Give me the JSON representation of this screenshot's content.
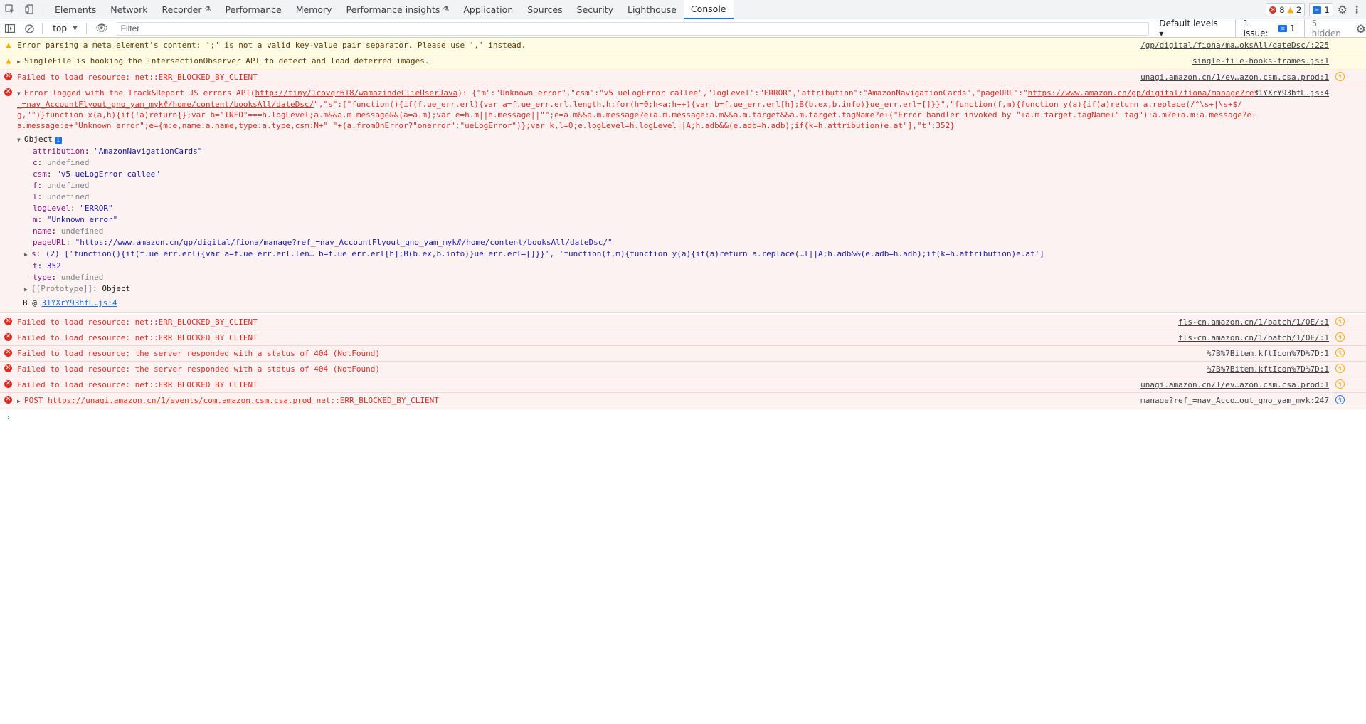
{
  "tabs": [
    {
      "label": "Elements"
    },
    {
      "label": "Network"
    },
    {
      "label": "Recorder",
      "flask": "⚗"
    },
    {
      "label": "Performance"
    },
    {
      "label": "Memory"
    },
    {
      "label": "Performance insights",
      "flask": "⚗"
    },
    {
      "label": "Application"
    },
    {
      "label": "Sources"
    },
    {
      "label": "Security"
    },
    {
      "label": "Lighthouse"
    },
    {
      "label": "Console"
    }
  ],
  "counts": {
    "errors": "8",
    "warnings": "2",
    "messages": "1"
  },
  "toolbar": {
    "context": "top",
    "filter_placeholder": "Filter",
    "levels": "Default levels ▾",
    "issues_label": "1 Issue:",
    "issues_count": "1",
    "hidden": "5 hidden"
  },
  "messages": {
    "m0": {
      "text": "Error parsing a meta element's content: ';' is not a valid key-value pair separator. Please use ',' instead.",
      "source": "/gp/digital/fiona/ma…oksAll/dateDsc/:225"
    },
    "m1": {
      "text": "SingleFile is hooking the IntersectionObserver API to detect and load deferred images.",
      "source": "single-file-hooks-frames.js:1"
    },
    "m2": {
      "text": "Failed to load resource: net::ERR_BLOCKED_BY_CLIENT",
      "source": "unagi.amazon.cn/1/ev…azon.csm.csa.prod:1"
    },
    "m3": {
      "prefix": "Error logged with the Track&Report JS errors API(",
      "api_link": "http://tiny/1covqr618/wamazindeClieUserJava",
      "after_link": "): {\"m\":\"Unknown error\",\"csm\":\"v5 ueLogError callee\",\"logLevel\":\"ERROR\",\"attribution\":\"AmazonNavigationCards\",\"pageURL\":\"",
      "page_link": "https://www.amazon.cn/gp/digital/fiona/manage?ref_=nav_AccountFlyout_gno_yam_myk#/home/content/booksAll/dateDsc/",
      "rest": "\",\"s\":[\"function(){if(f.ue_err.erl){var a=f.ue_err.erl.length,h;for(h=0;h<a;h++){var b=f.ue_err.erl[h];B(b.ex,b.info)}ue_err.erl=[]}}\",\"function(f,m){function y(a){if(a)return a.replace(/^\\s+|\\s+$/g,\"\")}function x(a,h){if(!a)return{};var b=\"INFO\"===h.logLevel;a.m&&a.m.message&&(a=a.m);var e=h.m||h.message||\"\";e=a.m&&a.m.message?e+a.m.message:a.m&&a.m.target&&a.m.target.tagName?e+(\"Error handler invoked by \"+a.m.target.tagName+\" tag\"):a.m?e+a.m:a.message?e+a.message:e+\"Unknown error\";e={m:e,name:a.name,type:a.type,csm:N+\" \"+(a.fromOnError?\"onerror\":\"ueLogError\")};var k,l=0;e.logLevel=h.logLevel||A;h.adb&&(e.adb=h.adb);if(k=h.attribution)e.at\"],\"t\":352}",
      "source": "31YXrY93hfL.js:4"
    },
    "m4": {
      "text": "Failed to load resource: net::ERR_BLOCKED_BY_CLIENT",
      "source": "fls-cn.amazon.cn/1/batch/1/OE/:1"
    },
    "m5": {
      "text": "Failed to load resource: net::ERR_BLOCKED_BY_CLIENT",
      "source": "fls-cn.amazon.cn/1/batch/1/OE/:1"
    },
    "m6": {
      "text": "Failed to load resource: the server responded with a status of 404 (NotFound)",
      "source": "%7B%7Bitem.kftIcon%7D%7D:1"
    },
    "m7": {
      "text": "Failed to load resource: the server responded with a status of 404 (NotFound)",
      "source": "%7B%7Bitem.kftIcon%7D%7D:1"
    },
    "m8": {
      "text": "Failed to load resource: net::ERR_BLOCKED_BY_CLIENT",
      "source": "unagi.amazon.cn/1/ev…azon.csm.csa.prod:1"
    },
    "m9": {
      "method": "POST",
      "url": "https://unagi.amazon.cn/1/events/com.amazon.csm.csa.prod",
      "error": "net::ERR_BLOCKED_BY_CLIENT",
      "source": "manage?ref_=nav_Acco…out_gno_yam_myk:247"
    }
  },
  "object": {
    "header": "Object",
    "props": {
      "attribution": {
        "key": "attribution",
        "val": "\"AmazonNavigationCards\""
      },
      "c": {
        "key": "c",
        "val": "undefined"
      },
      "csm": {
        "key": "csm",
        "val": "\"v5 ueLogError callee\""
      },
      "f": {
        "key": "f",
        "val": "undefined"
      },
      "l": {
        "key": "l",
        "val": "undefined"
      },
      "logLevel": {
        "key": "logLevel",
        "val": "\"ERROR\""
      },
      "m": {
        "key": "m",
        "val": "\"Unknown error\""
      },
      "name": {
        "key": "name",
        "val": "undefined"
      },
      "pageURL": {
        "key": "pageURL",
        "val": "\"https://www.amazon.cn/gp/digital/fiona/manage?ref_=nav_AccountFlyout_gno_yam_myk#/home/content/booksAll/dateDsc/\""
      },
      "s": {
        "key": "s",
        "val": "(2) ['function(){if(f.ue_err.erl){var a=f.ue_err.erl.len… b=f.ue_err.erl[h];B(b.ex,b.info)}ue_err.erl=[]}}', 'function(f,m){function y(a){if(a)return a.replace(…l||A;h.adb&&(e.adb=h.adb);if(k=h.attribution)e.at']"
      },
      "t": {
        "key": "t",
        "val": "352"
      },
      "type": {
        "key": "type",
        "val": "undefined"
      },
      "proto": {
        "key": "[[Prototype]]",
        "val": "Object"
      }
    },
    "stack_fn": "B @ ",
    "stack_link": "31YXrY93hfL.js:4"
  },
  "prompt": "›"
}
